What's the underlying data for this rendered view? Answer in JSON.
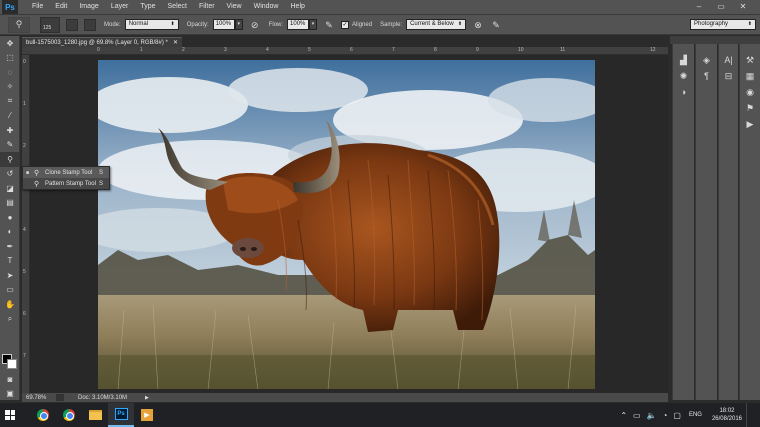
{
  "app": {
    "logo": "Ps",
    "menu": [
      "File",
      "Edit",
      "Image",
      "Layer",
      "Type",
      "Select",
      "Filter",
      "View",
      "Window",
      "Help"
    ],
    "window_controls": [
      "–",
      "▭",
      "✕"
    ]
  },
  "options_bar": {
    "brush_size": "125",
    "mode_label": "Mode:",
    "mode_value": "Normal",
    "opacity_label": "Opacity:",
    "opacity_value": "100%",
    "flow_label": "Flow:",
    "flow_value": "100%",
    "aligned_label": "Aligned",
    "aligned_checked": true,
    "sample_label": "Sample:",
    "sample_value": "Current & Below",
    "workspace": "Photography"
  },
  "document": {
    "tab_title": "bull-1575003_1280.jpg @ 69.8% (Layer 0, RGB/8#) *",
    "ruler_marks": [
      "0",
      "1",
      "2",
      "3",
      "4",
      "5",
      "6",
      "7",
      "8",
      "9",
      "10",
      "11",
      "12"
    ],
    "status_zoom": "69.78%",
    "status_doc": "Doc: 3.10M/3.10M"
  },
  "flyout": {
    "items": [
      {
        "label": "Clone Stamp Tool",
        "shortcut": "S"
      },
      {
        "label": "Pattern Stamp Tool",
        "shortcut": "S"
      }
    ]
  },
  "tools": [
    "move-icon",
    "marquee-icon",
    "lasso-icon",
    "quick-select-icon",
    "crop-icon",
    "eyedropper-icon",
    "healing-icon",
    "brush-icon",
    "clone-stamp-icon",
    "history-brush-icon",
    "eraser-icon",
    "gradient-icon",
    "blur-icon",
    "dodge-icon",
    "pen-icon",
    "type-icon",
    "path-select-icon",
    "rectangle-icon",
    "hand-icon",
    "zoom-icon"
  ],
  "taskbar": {
    "language": "ENG",
    "time": "18:02",
    "date": "26/08/2016"
  },
  "colors": {
    "panel": "#535353",
    "canvas_bg": "#282828",
    "accent": "#31a8ff"
  }
}
